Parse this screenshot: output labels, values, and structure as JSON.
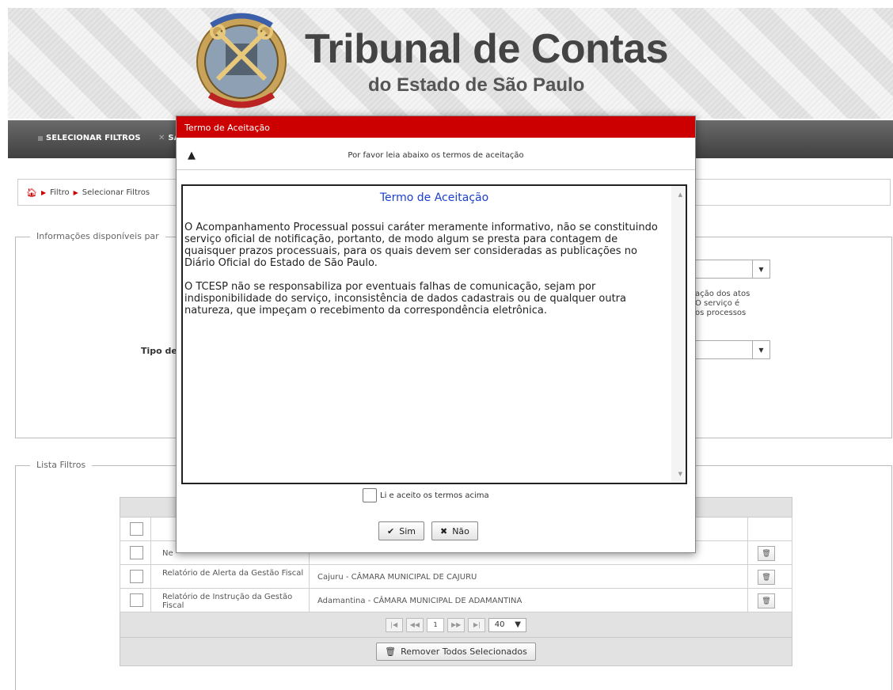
{
  "header": {
    "title": "Tribunal de Contas",
    "subtitle": "do Estado de São Paulo"
  },
  "nav": {
    "items": [
      {
        "label": "SELECIONAR FILTROS"
      },
      {
        "label": "SA"
      }
    ]
  },
  "breadcrumb": {
    "items": [
      "Filtro",
      "Selecionar Filtros"
    ]
  },
  "info_panel": {
    "legend": "Informações disponíveis par",
    "tipo_label": "Tipo de",
    "snippet_lines": [
      "ação dos atos",
      "O serviço é",
      "os processos"
    ]
  },
  "list_panel": {
    "legend": "Lista Filtros",
    "rows": [
      {
        "filter": "Ne",
        "entity": ""
      },
      {
        "filter": "Relatório de Alerta da Gestão Fiscal",
        "entity": "Cajuru - CÂMARA MUNICIPAL DE CAJURU"
      },
      {
        "filter": "Relatório de Instrução da Gestão Fiscal",
        "entity": "Adamantina - CÂMARA MUNICIPAL DE ADAMANTINA"
      }
    ],
    "pager": {
      "page": "1",
      "page_size": "40"
    },
    "remove_all_label": "Remover Todos Selecionados"
  },
  "dialog": {
    "title": "Termo de Aceitação",
    "notice": "Por favor leia abaixo os termos de aceitação",
    "terms_title": "Termo de Aceitação",
    "terms_p1": "O Acompanhamento Processual possui caráter meramente informativo, não se constituindo serviço oficial de notificação, portanto, de modo algum se presta para contagem de quaisquer prazos processuais, para os quais devem ser consideradas as publicações no Diário Oficial do Estado de São Paulo.",
    "terms_p2": "O TCESP não se responsabiliza por eventuais falhas de comunicação, sejam por indisponibilidade do serviço, inconsistência de dados cadastrais ou de qualquer outra natureza, que impeçam o recebimento da correspondência eletrônica.",
    "accept_label": "Li e aceito os termos acima",
    "yes_label": "Sim",
    "no_label": "Não"
  },
  "colors": {
    "dialog_header": "#cc0000",
    "terms_title": "#1a3fd0",
    "breadcrumb_accent": "#cc0000"
  }
}
